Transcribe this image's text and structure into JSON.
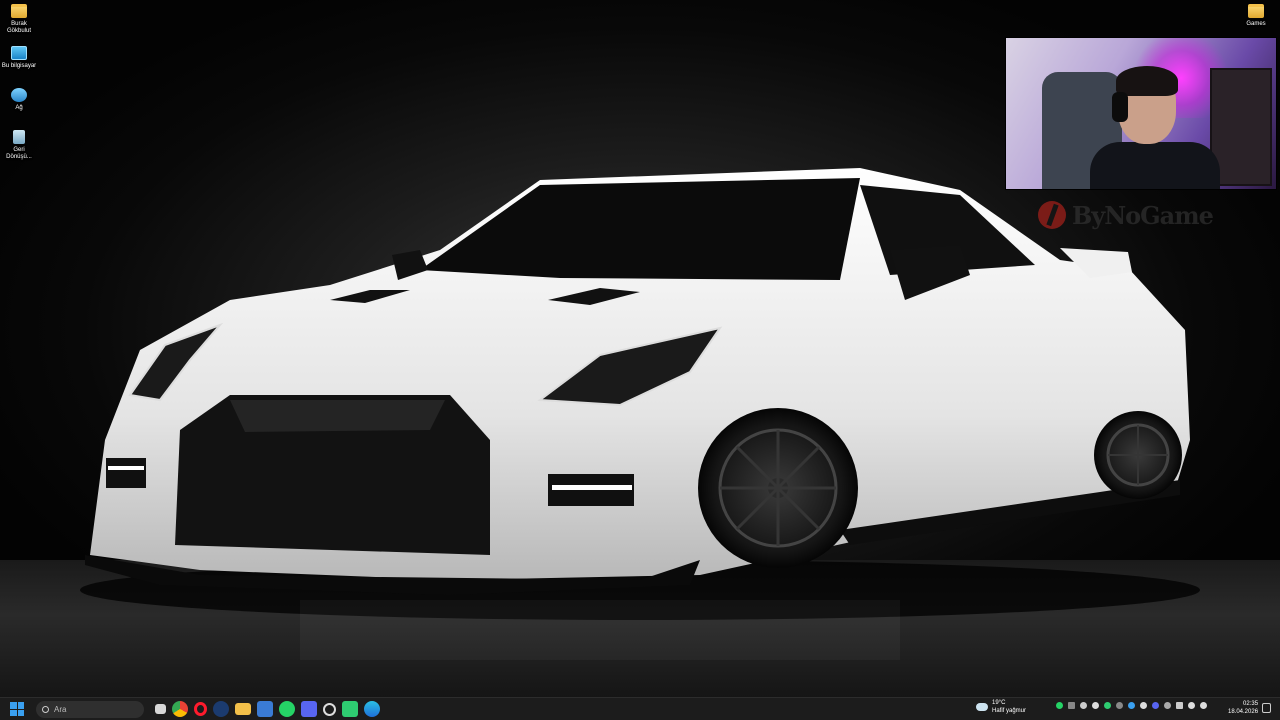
{
  "desktop": {
    "icons": [
      {
        "label": "Burak Gökbulut",
        "icon": "folder-icon"
      },
      {
        "label": "Bu bilgisayar",
        "icon": "pc-icon"
      },
      {
        "label": "Ağ",
        "icon": "network-icon"
      },
      {
        "label": "Geri Dönüşü...",
        "icon": "recycle-bin-icon"
      },
      {
        "label": "Games",
        "icon": "folder-icon"
      }
    ],
    "watermark": "ByNoGame"
  },
  "taskbar": {
    "search_label": "Ara",
    "pinned": [
      "file-explorer-icon",
      "chrome-icon",
      "opera-icon",
      "steam-icon",
      "folder-icon",
      "store-icon",
      "whatsapp-icon",
      "discord-icon",
      "obs-icon",
      "app-icon",
      "edge-icon"
    ],
    "weather_temp": "19°C",
    "weather_desc": "Hafif yağmur",
    "clock_time": "02:35",
    "clock_date": "18.04.2026"
  },
  "colors": {
    "accent": "#3aa0f0",
    "wallpaper_bg": "#0a0a0a",
    "car_body": "#eeeeee"
  }
}
